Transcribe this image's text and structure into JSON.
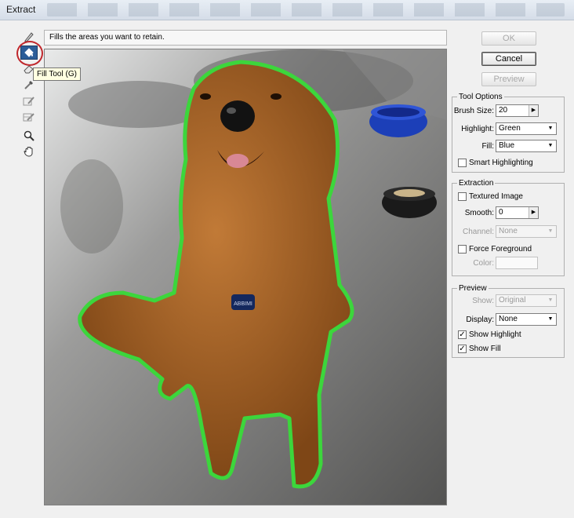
{
  "window": {
    "title": "Extract"
  },
  "hint": {
    "text": "Fills the areas you want to retain."
  },
  "tooltip": {
    "text": "Fill Tool (G)"
  },
  "tools": [
    {
      "name": "edge-highlighter-tool-icon"
    },
    {
      "name": "fill-tool-icon",
      "selected": true
    },
    {
      "name": "eraser-tool-icon"
    },
    {
      "name": "eyedropper-tool-icon"
    },
    {
      "name": "cleanup-tool-icon"
    },
    {
      "name": "edge-touchup-tool-icon"
    },
    {
      "name": "zoom-tool-icon"
    },
    {
      "name": "hand-tool-icon"
    }
  ],
  "buttons": {
    "ok": "OK",
    "cancel": "Cancel",
    "preview": "Preview"
  },
  "tool_options": {
    "legend": "Tool Options",
    "brush_size_label": "Brush Size:",
    "brush_size_value": "20",
    "highlight_label": "Highlight:",
    "highlight_value": "Green",
    "fill_label": "Fill:",
    "fill_value": "Blue",
    "smart_highlighting_label": "Smart Highlighting",
    "smart_highlighting_checked": false
  },
  "extraction": {
    "legend": "Extraction",
    "textured_image_label": "Textured Image",
    "textured_image_checked": false,
    "smooth_label": "Smooth:",
    "smooth_value": "0",
    "channel_label": "Channel:",
    "channel_value": "None",
    "force_foreground_label": "Force Foreground",
    "force_foreground_checked": false,
    "color_label": "Color:"
  },
  "preview_group": {
    "legend": "Preview",
    "show_label": "Show:",
    "show_value": "Original",
    "display_label": "Display:",
    "display_value": "None",
    "show_highlight_label": "Show Highlight",
    "show_highlight_checked": true,
    "show_fill_label": "Show Fill",
    "show_fill_checked": true
  },
  "image": {
    "collar_tag_text": "ABBIMI",
    "highlight_color": "#39d63a",
    "fur_color": "#b06a2c"
  }
}
